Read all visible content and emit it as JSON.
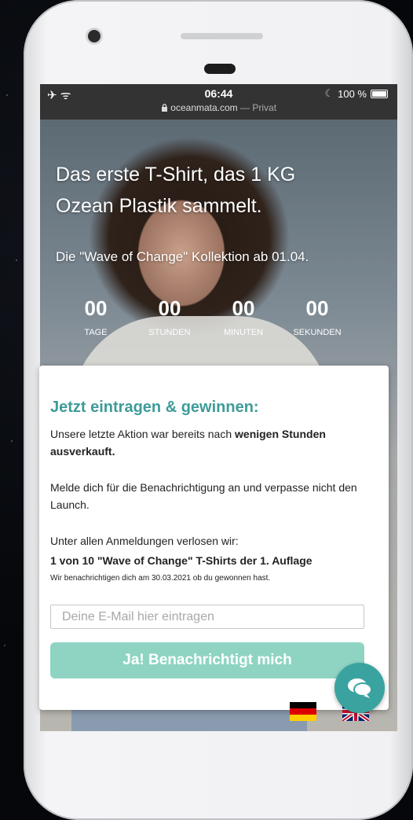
{
  "status_bar": {
    "left_icons": "✈ ᯤ",
    "time": "06:44",
    "url": "oceanmata.com",
    "url_suffix": " — Privat",
    "moon": "☾",
    "battery_percent": "100 %",
    "battery_level": 1.0
  },
  "hero": {
    "headline_line1": "Das erste T-Shirt, das 1 KG",
    "headline_line2": "Ozean Plastik sammelt.",
    "subline": "Die \"Wave of Change\" Kollektion ab 01.04.",
    "countdown": [
      {
        "value": "00",
        "label": "TAGE"
      },
      {
        "value": "00",
        "label": "STUNDEN"
      },
      {
        "value": "00",
        "label": "MINUTEN"
      },
      {
        "value": "00",
        "label": "SEKUNDEN"
      }
    ]
  },
  "signup": {
    "title": "Jetzt eintragen & gewinnen:",
    "p1_text": "Unsere letzte Aktion war bereits nach ",
    "p1_bold": "wenigen Stunden ausverkauft.",
    "p2": "Melde dich für die Benachrichtigung an und verpasse nicht den Launch.",
    "p3": "Unter allen  Anmeldungen verlosen wir:",
    "p4": "1 von 10 \"Wave of Change\" T-Shirts der 1. Auflage",
    "p5": "Wir benachrichtigen dich am 30.03.2021 ob du gewonnen hast.",
    "email_placeholder": "Deine E-Mail hier eintragen",
    "button_label": "Ja! Benachrichtigt mich"
  },
  "colors": {
    "accent": "#3d9c98",
    "button": "#8fd4c3",
    "chat": "#3aa3a0"
  },
  "icons": {
    "flag_de": "german-flag-icon",
    "flag_uk": "uk-flag-icon",
    "chat": "chat-bubble-icon",
    "lock": "lock-icon"
  }
}
